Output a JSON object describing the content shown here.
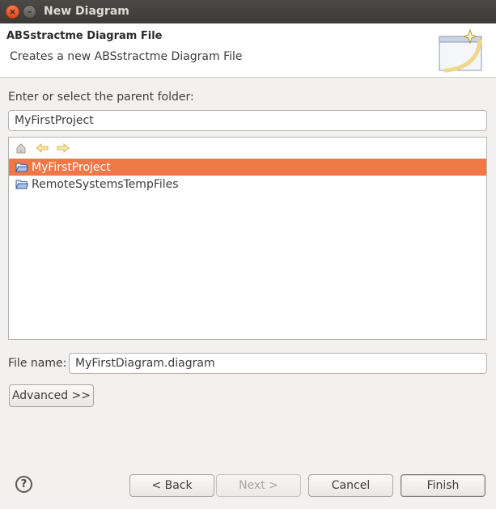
{
  "window": {
    "title": "New Diagram"
  },
  "banner": {
    "title": "ABSstractme Diagram File",
    "description": "Creates a new ABSstractme Diagram File"
  },
  "folder": {
    "label": "Enter or select the parent folder:",
    "value": "MyFirstProject"
  },
  "tree": {
    "toolbar_icons": [
      "home-icon",
      "back-arrow-icon",
      "forward-arrow-icon"
    ],
    "items": [
      {
        "label": "MyFirstProject",
        "selected": true
      },
      {
        "label": "RemoteSystemsTempFiles",
        "selected": false
      }
    ]
  },
  "file": {
    "label": "File name:",
    "value": "MyFirstDiagram.diagram"
  },
  "buttons": {
    "advanced": "Advanced >>",
    "back": "< Back",
    "next": "Next >",
    "cancel": "Cancel",
    "finish": "Finish"
  },
  "help": {
    "glyph": "?"
  },
  "colors": {
    "selection": "#f07746",
    "titlebar": "#3b3a36",
    "close_button": "#df4a16"
  }
}
